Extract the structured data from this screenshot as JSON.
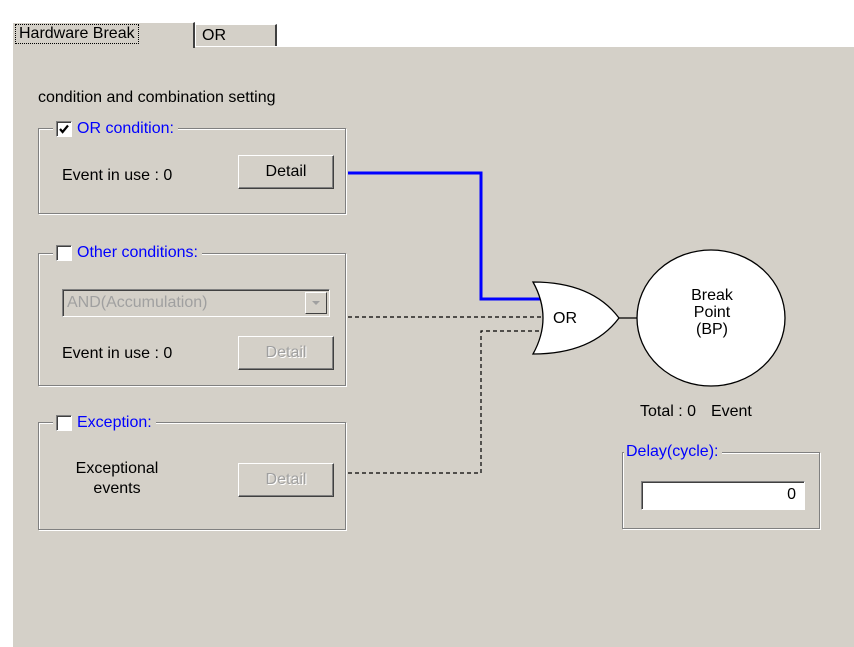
{
  "tabs": [
    {
      "label": "Hardware Break",
      "active": true
    },
    {
      "label": "OR",
      "active": false
    }
  ],
  "section_title": "condition and combination setting",
  "or_condition": {
    "label": "OR condition:",
    "checked": true,
    "event_text": "Event in use : 0",
    "detail_label": "Detail"
  },
  "other_conditions": {
    "label": "Other conditions:",
    "checked": false,
    "combo_value": "AND(Accumulation)",
    "event_text": "Event in use : 0",
    "detail_label": "Detail"
  },
  "exception": {
    "label": "Exception:",
    "checked": false,
    "text_line1": "Exceptional",
    "text_line2": "events",
    "detail_label": "Detail"
  },
  "gate_label": "OR",
  "breakpoint": {
    "line1": "Break",
    "line2": "Point",
    "line3": "(BP)"
  },
  "total": {
    "prefix": "Total :",
    "count": "0",
    "suffix": "Event"
  },
  "delay": {
    "label": "Delay(cycle):",
    "value": "0"
  },
  "colors": {
    "accent": "#0000ff",
    "panel": "#d4d0c8",
    "disabled_text": "#a0a0a0"
  },
  "icons": {
    "checkbox_mark": "check-icon",
    "combo_arrow": "chevron-down-icon"
  }
}
